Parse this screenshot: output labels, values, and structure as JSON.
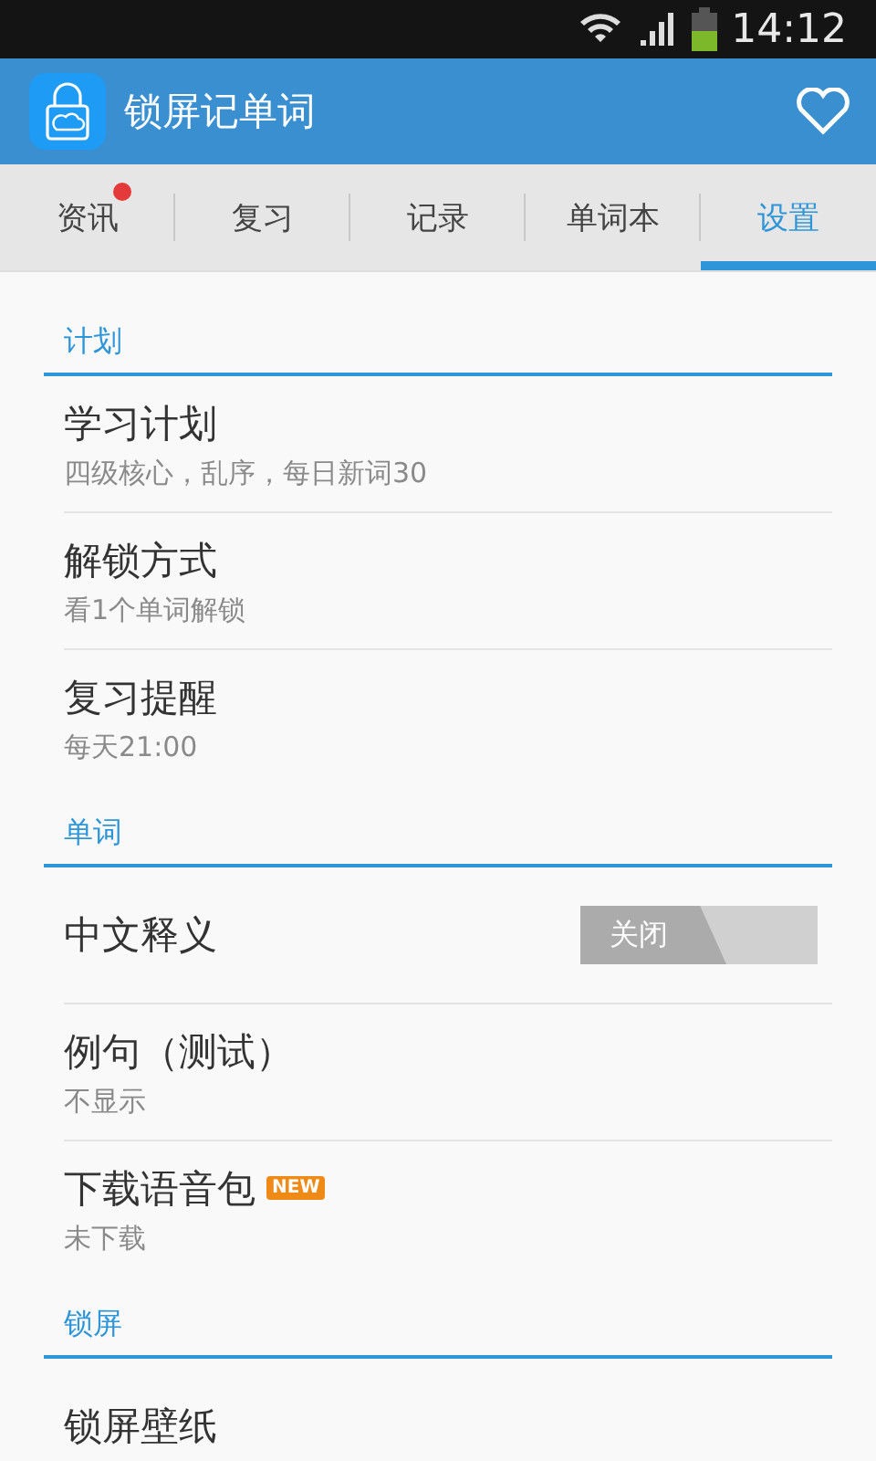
{
  "status_bar": {
    "time": "14:12"
  },
  "app_bar": {
    "title": "锁屏记单词"
  },
  "tabs": [
    {
      "label": "资讯",
      "selected": false,
      "dot": true
    },
    {
      "label": "复习",
      "selected": false,
      "dot": false
    },
    {
      "label": "记录",
      "selected": false,
      "dot": false
    },
    {
      "label": "单词本",
      "selected": false,
      "dot": false
    },
    {
      "label": "设置",
      "selected": true,
      "dot": false
    }
  ],
  "sections": [
    {
      "header": "计划",
      "items": [
        {
          "kind": "detail",
          "title": "学习计划",
          "subtitle": "四级核心，乱序，每日新词30"
        },
        {
          "kind": "detail",
          "title": "解锁方式",
          "subtitle": "看1个单词解锁"
        },
        {
          "kind": "detail",
          "title": "复习提醒",
          "subtitle": "每天21:00"
        }
      ]
    },
    {
      "header": "单词",
      "items": [
        {
          "kind": "toggle",
          "title": "中文释义",
          "toggle": {
            "label": "关闭",
            "on": false
          }
        },
        {
          "kind": "detail",
          "title": "例句（测试）",
          "subtitle": "不显示"
        },
        {
          "kind": "detail",
          "title": "下载语音包",
          "badge": "NEW",
          "subtitle": "未下载"
        }
      ]
    },
    {
      "header": "锁屏",
      "items": [
        {
          "kind": "detail",
          "title": "锁屏壁纸"
        }
      ]
    }
  ]
}
